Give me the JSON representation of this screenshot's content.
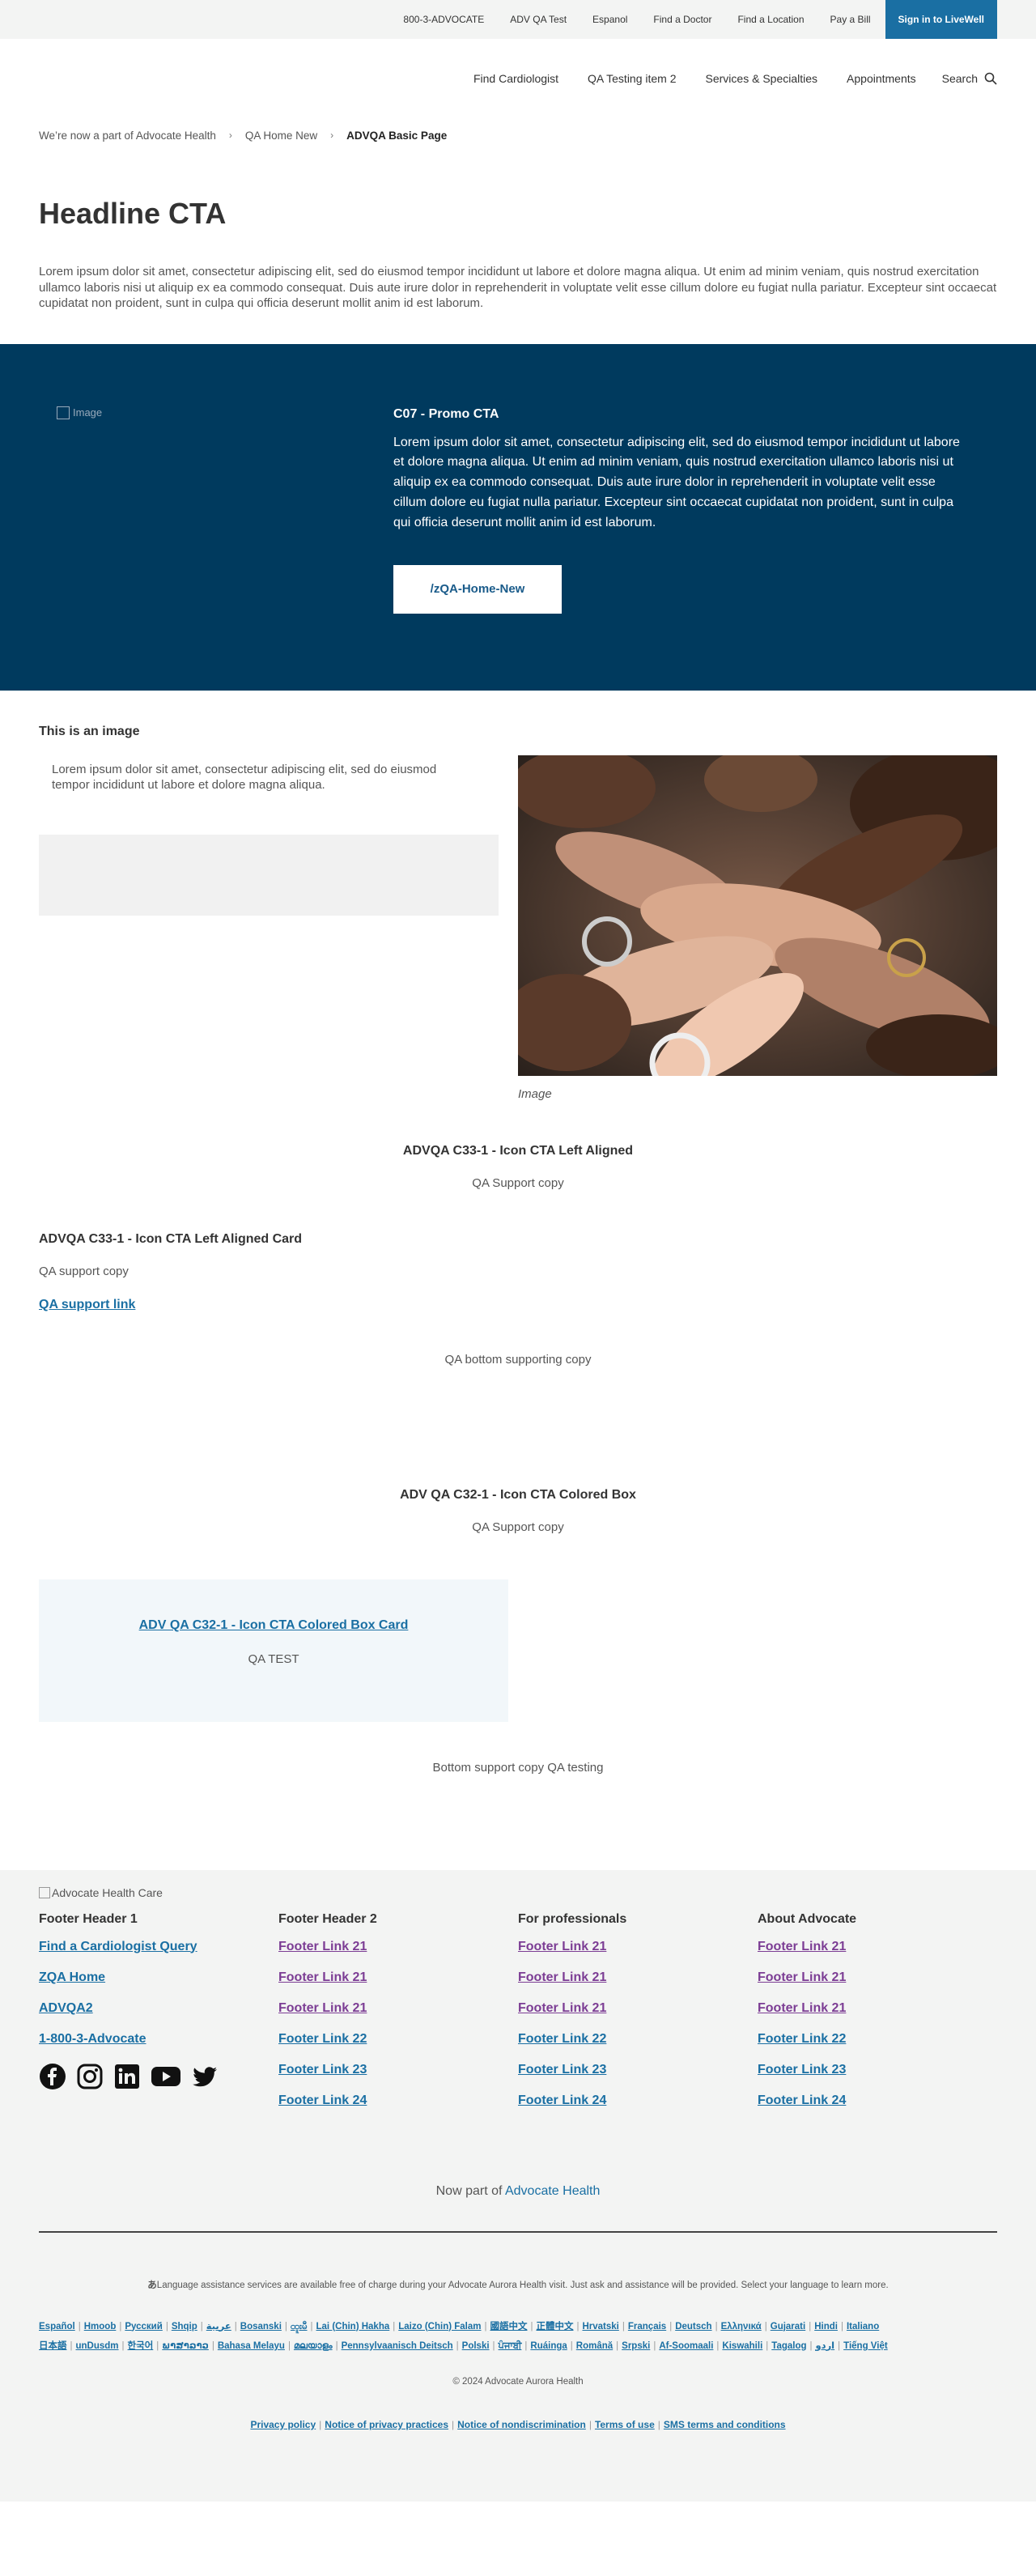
{
  "utility": {
    "links": [
      "800-3-ADVOCATE",
      "ADV QA Test",
      "Espanol",
      "Find a Doctor",
      "Find a Location",
      "Pay a Bill"
    ],
    "signin": "Sign in to LiveWell"
  },
  "nav": {
    "items": [
      "Find Cardiologist",
      "QA Testing item 2",
      "Services & Specialties",
      "Appointments"
    ],
    "search": "Search"
  },
  "breadcrumb": {
    "items": [
      "We’re now a part of Advocate Health",
      "QA Home New"
    ],
    "current": "ADVQA Basic Page"
  },
  "page": {
    "title": "Headline CTA",
    "intro": "Lorem ipsum dolor sit amet, consectetur adipiscing elit, sed do eiusmod tempor incididunt ut labore et dolore magna aliqua. Ut enim ad minim veniam, quis nostrud exercitation ullamco laboris nisi ut aliquip ex ea commodo consequat. Duis aute irure dolor in reprehenderit in voluptate velit esse cillum dolore eu fugiat nulla pariatur. Excepteur sint occaecat cupidatat non proident, sunt in culpa qui officia deserunt mollit anim id est laborum."
  },
  "promo": {
    "img_alt": "Image",
    "title": "C07 - Promo CTA",
    "body": "Lorem ipsum dolor sit amet, consectetur adipiscing elit, sed do eiusmod tempor incididunt ut labore et dolore magna aliqua. Ut enim ad minim veniam, quis nostrud exercitation ullamco laboris nisi ut aliquip ex ea commodo consequat. Duis aute irure dolor in reprehenderit in voluptate velit esse cillum dolore eu fugiat nulla pariatur. Excepteur sint occaecat cupidatat non proident, sunt in culpa qui officia deserunt mollit anim id est laborum.",
    "button": "/zQA-Home-New"
  },
  "image_section": {
    "heading": "This is an image",
    "text": "Lorem ipsum dolor sit amet, consectetur adipiscing elit, sed do eiusmod tempor incididunt ut labore et dolore magna aliqua.",
    "caption": "Image"
  },
  "c33": {
    "heading": "ADVQA C33-1 - Icon CTA Left Aligned",
    "support": "QA Support copy",
    "card_title": "ADVQA C33-1 - Icon CTA Left Aligned Card",
    "card_copy": "QA support copy",
    "card_link": "QA support link",
    "bottom": "QA bottom supporting copy"
  },
  "c32": {
    "heading": "ADV QA C32-1 - Icon CTA Colored Box",
    "support": "QA Support copy",
    "box_link": "ADV QA C32-1 - Icon CTA Colored Box Card",
    "box_copy": "QA TEST",
    "bottom": "Bottom support copy QA testing"
  },
  "footer": {
    "logo_alt": "Advocate Health Care",
    "col1": {
      "header": "Footer Header 1",
      "links": [
        "Find a Cardiologist Query",
        "ZQA Home",
        "ADVQA2",
        "1-800-3-Advocate"
      ]
    },
    "col2": {
      "header": "Footer Header 2",
      "links": [
        "Footer Link 21",
        "Footer Link 21",
        "Footer Link 21",
        "Footer Link 22",
        "Footer Link 23",
        "Footer Link 24"
      ]
    },
    "col3": {
      "header": "For professionals",
      "links": [
        "Footer Link 21",
        "Footer Link 21",
        "Footer Link 21",
        "Footer Link 22",
        "Footer Link 23",
        "Footer Link 24"
      ]
    },
    "col4": {
      "header": "About Advocate",
      "links": [
        "Footer Link 21",
        "Footer Link 21",
        "Footer Link 21",
        "Footer Link 22",
        "Footer Link 23",
        "Footer Link 24"
      ]
    },
    "partof_prefix": "Now part of",
    "partof_link": "Advocate Health",
    "lang_icon": "あ",
    "lang_note": "Language assistance services are available free of charge during your Advocate Aurora Health visit. Just ask and assistance will be provided. Select your language to learn more.",
    "languages_row1": [
      "Español",
      "Hmoob",
      "Русский",
      "Shqip",
      "عربية",
      "Bosanski",
      "ထူးမီ",
      "Lai (Chin) Hakha",
      "Laizo (Chin) Falam",
      "國語中文",
      "正體中文",
      "Hrvatski",
      "Français",
      "Deutsch",
      "Ελληνικά",
      "Gujarati",
      "Hindi",
      "Italiano"
    ],
    "languages_row2": [
      "日本語",
      "unDusdm",
      "한국어",
      "ພາສາລາວ",
      "Bahasa Melayu",
      "മലയാളം",
      "Pennsylvaanisch Deitsch",
      "Polski",
      "ਪੰਜਾਬੀ",
      "Ruáinga",
      "Română",
      "Srpski",
      "Af-Soomaali",
      "Kiswahili",
      "Tagalog",
      "اردو",
      "Tiếng Việt"
    ],
    "copyright": "© 2024 Advocate Aurora Health",
    "legal": [
      "Privacy policy",
      "Notice of privacy practices",
      "Notice of nondiscrimination",
      "Terms of use",
      "SMS terms and conditions"
    ]
  }
}
